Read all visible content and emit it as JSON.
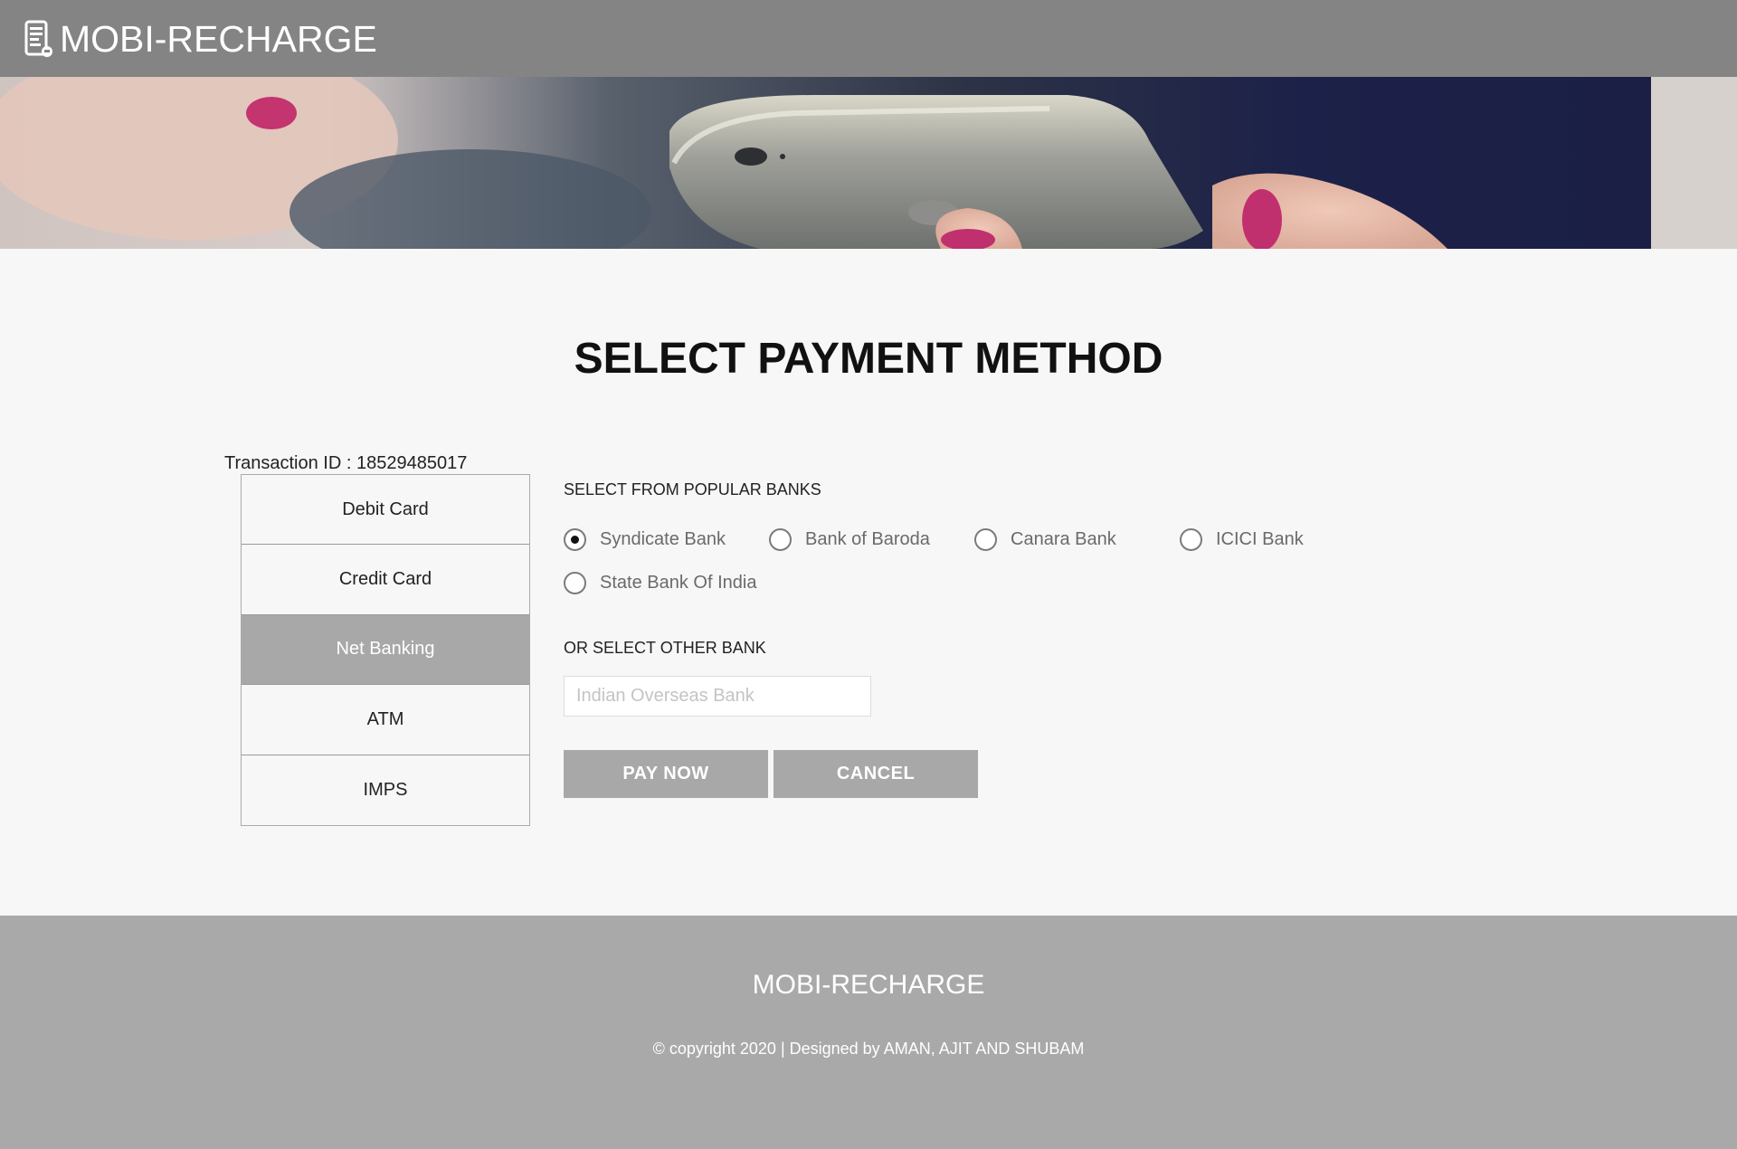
{
  "header": {
    "brand": "MOBI-RECHARGE",
    "brand_icon": "phone-receipt-icon"
  },
  "hero": {
    "image": "hand-holding-smartphone"
  },
  "main": {
    "title": "SELECT PAYMENT METHOD",
    "transaction_id": "Transaction ID : 18529485017"
  },
  "payment_methods": [
    {
      "label": "Debit Card",
      "active": false
    },
    {
      "label": "Credit Card",
      "active": false
    },
    {
      "label": "Net Banking",
      "active": true
    },
    {
      "label": "ATM",
      "active": false
    },
    {
      "label": "IMPS",
      "active": false
    }
  ],
  "net_banking": {
    "popular_label": "SELECT FROM POPULAR BANKS",
    "banks": [
      {
        "label": "Syndicate Bank",
        "selected": true
      },
      {
        "label": "Bank of Baroda",
        "selected": false
      },
      {
        "label": "Canara Bank",
        "selected": false
      },
      {
        "label": "ICICI Bank",
        "selected": false
      },
      {
        "label": "State Bank Of India",
        "selected": false
      }
    ],
    "other_label": "OR SELECT OTHER BANK",
    "other_placeholder": "Indian Overseas Bank",
    "other_value": "",
    "pay_label": "PAY NOW",
    "cancel_label": "CANCEL"
  },
  "footer": {
    "brand": "MOBI-RECHARGE",
    "copyright": "© copyright 2020 | Designed by AMAN, AJIT AND SHUBAM"
  },
  "colors": {
    "header_bg": "#848484",
    "footer_bg": "#a9a9a9",
    "active_tab": "#a8a8a8",
    "button_bg": "#a8a8a8",
    "page_bg": "#f7f7f7"
  }
}
